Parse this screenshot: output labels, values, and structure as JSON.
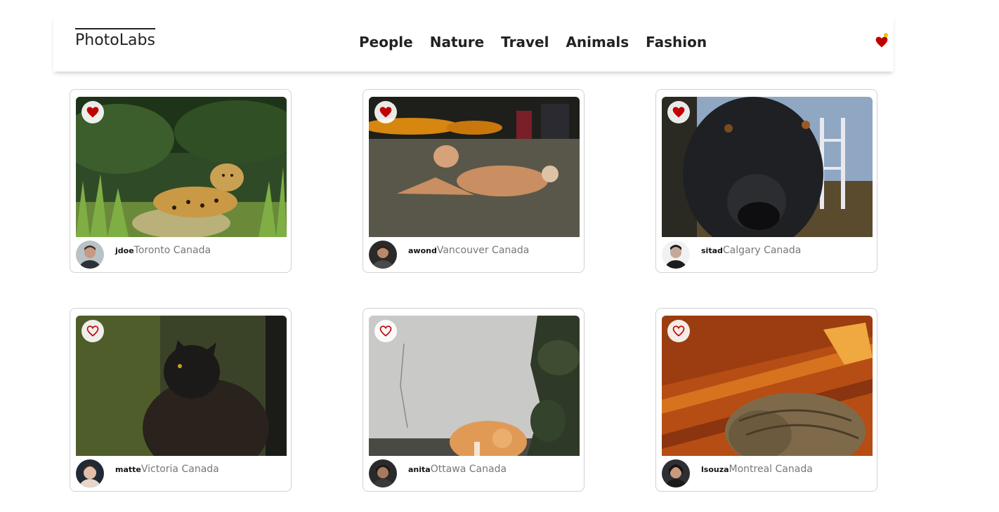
{
  "app": {
    "logo": "PhotoLabs"
  },
  "nav": {
    "topics": [
      {
        "label": "People"
      },
      {
        "label": "Nature"
      },
      {
        "label": "Travel"
      },
      {
        "label": "Animals"
      },
      {
        "label": "Fashion"
      }
    ]
  },
  "header": {
    "fav_icon": "heart-icon",
    "notification_color": "#f2c200"
  },
  "colors": {
    "accent": "#c00000",
    "text": "#222222",
    "location": "#777777"
  },
  "photos": [
    {
      "username": "jdoe",
      "location": "Toronto Canada",
      "liked": true,
      "subject": "jaguar"
    },
    {
      "username": "awond",
      "location": "Vancouver Canada",
      "liked": true,
      "subject": "dog"
    },
    {
      "username": "sitad",
      "location": "Calgary Canada",
      "liked": true,
      "subject": "black-dog"
    },
    {
      "username": "matte",
      "location": "Victoria Canada",
      "liked": false,
      "subject": "black-cat"
    },
    {
      "username": "anita",
      "location": "Ottawa Canada",
      "liked": false,
      "subject": "orange-cat"
    },
    {
      "username": "lsouza",
      "location": "Montreal Canada",
      "liked": false,
      "subject": "tabby-cat"
    }
  ]
}
